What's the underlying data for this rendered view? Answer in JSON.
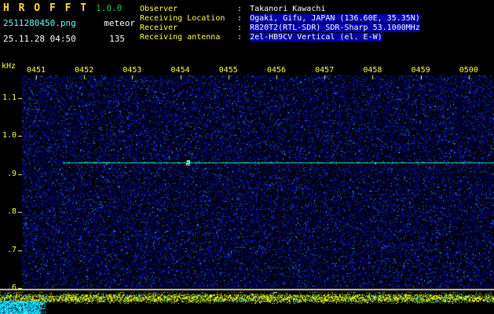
{
  "header": {
    "app_name": "H R O F F T",
    "version": "1.0.0",
    "file_name": "2511280450.png",
    "mode": "meteor",
    "datetime": "25.11.28 04:50",
    "count": "135"
  },
  "info": {
    "rows": [
      {
        "label": "Observer",
        "sep": ":",
        "value": "Takanori Kawachi",
        "highlighted": false
      },
      {
        "label": "Receiving Location",
        "sep": ":",
        "value": "Ogaki, Gifu, JAPAN (136.60E, 35.35N)",
        "highlighted": true
      },
      {
        "label": "Receiver",
        "sep": ":",
        "value": "R820T2(RTL-SDR) SDR-Sharp 53.1000MHz",
        "highlighted": true
      },
      {
        "label": "Receiving antenna",
        "sep": ":",
        "value": "2el-HB9CV Vertical (el. E-W)",
        "highlighted": true
      }
    ]
  },
  "chart_data": {
    "type": "heatmap",
    "subtype": "radio-meteor-spectrogram",
    "ylabel": "kHz",
    "x_ticks": [
      "0451",
      "0452",
      "0453",
      "0454",
      "0455",
      "0456",
      "0457",
      "0458",
      "0459",
      "0500"
    ],
    "y_ticks": [
      "1.1",
      "1.0",
      ".9",
      ".8",
      ".7",
      ".6"
    ],
    "y_range_khz": [
      0.58,
      1.16
    ],
    "x_span_minutes": 10,
    "carrier": {
      "freq_khz": 0.93,
      "start_offset_min": 0.55,
      "blip_offset_min": 3.15,
      "color": "#44ffaa",
      "description": "continuous narrow carrier line across the window with a brighter blip near 0454"
    },
    "noise_floor": "sparse blue speckle noise across full band",
    "divider_khz": 0.6,
    "level_strip": "yellow/green signal-level band below the white divider line, with dense cyan patch at lower left"
  },
  "colors": {
    "background": "#000000",
    "title_yellow": "#ffd633",
    "version_green": "#00cc44",
    "filename_cyan": "#66ffff",
    "header_text": "#ffffff",
    "label_yellow": "#ffff44",
    "value_highlight_bg": "#0000aa",
    "axis_yellow": "#ffff44",
    "carrier_green": "#44ffaa",
    "divider_white": "#eeeeee",
    "level_yellow": "#e1e100",
    "blob_cyan": "#00e1ff"
  }
}
